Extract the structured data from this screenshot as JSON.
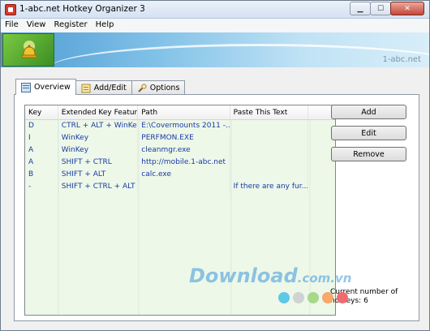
{
  "window": {
    "title": "1-abc.net Hotkey Organizer 3"
  },
  "menu": [
    "File",
    "View",
    "Register",
    "Help"
  ],
  "banner": {
    "brand": "1-abc.net"
  },
  "tabs": [
    {
      "label": "Overview",
      "icon": "overview-icon"
    },
    {
      "label": "Add/Edit",
      "icon": "notepad-icon"
    },
    {
      "label": "Options",
      "icon": "wrench-icon"
    }
  ],
  "table": {
    "headers": [
      "Key",
      "Extended Key Feature",
      "Path",
      "Paste This Text",
      ""
    ],
    "rows": [
      [
        "D",
        "CTRL + ALT + WinKey",
        "E:\\Covermounts 2011 -...",
        "",
        ""
      ],
      [
        "I",
        "WinKey",
        "PERFMON.EXE",
        "",
        ""
      ],
      [
        "A",
        "WinKey",
        "cleanmgr.exe",
        "",
        ""
      ],
      [
        "A",
        "SHIFT + CTRL",
        "http://mobile.1-abc.net",
        "",
        ""
      ],
      [
        "B",
        "SHIFT + ALT",
        "calc.exe",
        "",
        ""
      ],
      [
        "-",
        "SHIFT + CTRL + ALT",
        "",
        "If there are any fur...",
        ""
      ]
    ]
  },
  "buttons": {
    "add": "Add",
    "edit": "Edit",
    "remove": "Remove"
  },
  "status": {
    "text": "Current number of hotkeys: 6"
  },
  "watermark": {
    "main": "Download",
    "sub": ".com.vn"
  },
  "colors": {
    "list_bg": "#edf8e8",
    "list_text": "#1a3aa8",
    "banner": "#4c9ad3"
  }
}
